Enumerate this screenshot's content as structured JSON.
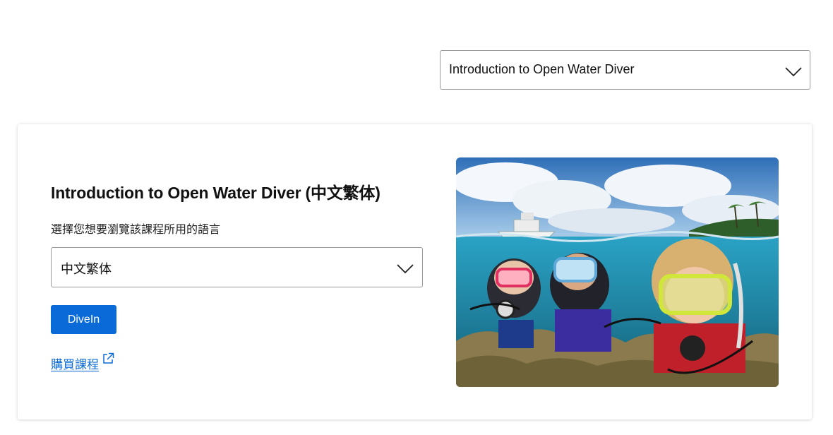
{
  "course_selector": {
    "value": "Introduction to Open Water Diver",
    "icon": "chevron-down-icon"
  },
  "card": {
    "title": "Introduction to Open Water Diver (中文繁体)",
    "language_prompt": "選擇您想要瀏覽該課程所用的語言",
    "language_select": {
      "value": "中文繁体",
      "icon": "chevron-down-icon"
    },
    "divein_label": "DiveIn",
    "buy_link": {
      "label": "購買課程",
      "icon": "external-link-icon"
    },
    "image_alt": "Three divers in masks at the water surface"
  },
  "colors": {
    "primary": "#0a6bd8",
    "border": "#9a9a9a"
  }
}
